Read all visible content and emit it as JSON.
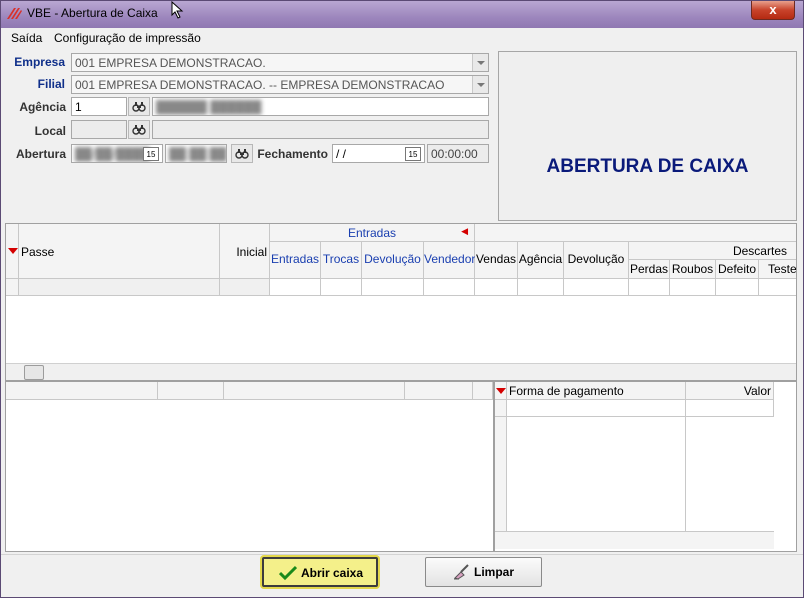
{
  "window": {
    "title": "VBE - Abertura de Caixa",
    "close_label": "x"
  },
  "menu": {
    "items": [
      "Saída",
      "Configuração de impressão"
    ]
  },
  "form": {
    "empresa_label": "Empresa",
    "empresa_value": "001 EMPRESA DEMONSTRACAO.",
    "filial_label": "Filial",
    "filial_value": "001 EMPRESA DEMONSTRACAO. -- EMPRESA DEMONSTRACAO",
    "agencia_label": "Agência",
    "agencia_code": "1",
    "local_label": "Local",
    "abertura_label": "Abertura",
    "fechamento_label": "Fechamento",
    "fechamento_date": " / /",
    "fechamento_time": "00:00:00",
    "calendar_icon_text": "15"
  },
  "banner": {
    "text": "ABERTURA DE CAIXA"
  },
  "grid_main": {
    "group_header": "Entradas",
    "col_passe": "Passe",
    "col_inicial": "Inicial",
    "cols": [
      "Entradas",
      "Trocas",
      "Devolução",
      "Vendedor",
      "Vendas",
      "Agência",
      "Devolução"
    ],
    "descartes_header": "Descartes",
    "descartes_cols": [
      "Perdas",
      "Roubos",
      "Defeito",
      "Teste"
    ]
  },
  "grid_payment": {
    "col_forma": "Forma de pagamento",
    "col_valor": "Valor"
  },
  "buttons": {
    "abrir_label": "Abrir caixa",
    "limpar_label": "Limpar"
  },
  "colors": {
    "title_gradient": "#9d86bd",
    "banner_text": "#0a1a7a",
    "accent_blue": "#1a3fb0",
    "sort_marker": "#d40000",
    "primary_button": "#f4f08a"
  }
}
